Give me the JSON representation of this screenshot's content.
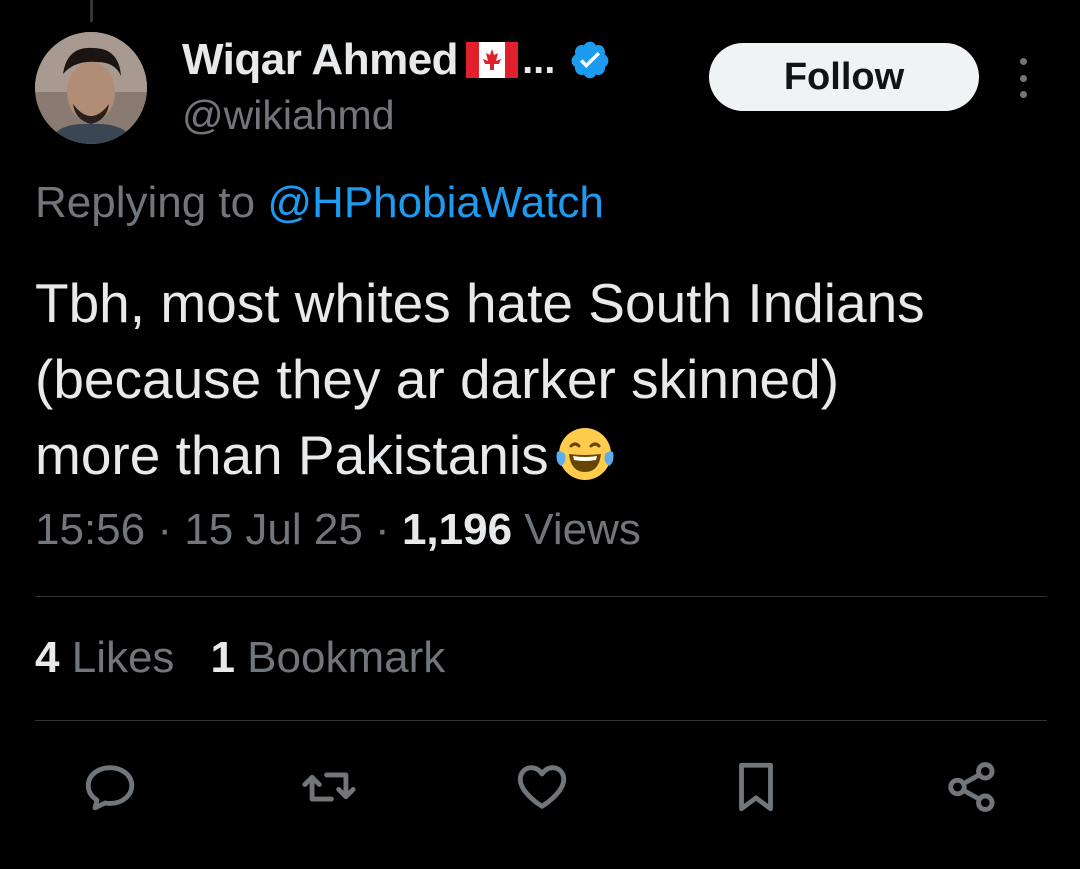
{
  "tweet": {
    "author": {
      "display_name": "Wiqar Ahmed",
      "name_truncation": "...",
      "handle": "@wikiahmd",
      "verified": true
    },
    "follow_label": "Follow",
    "reply_prefix": "Replying to",
    "reply_to": "@HPhobiaWatch",
    "text": "Tbh, most whites hate South Indians\n(because they ar darker skinned)\nmore than Pakistanis",
    "emoji": "face-with-tears-of-joy",
    "time": "15:56",
    "date": "15 Jul 25",
    "separator": "·",
    "views_count": "1,196",
    "views_label": "Views",
    "likes_count": "4",
    "likes_label": "Likes",
    "bookmarks_count": "1",
    "bookmarks_label": "Bookmark"
  },
  "icons": {
    "flag": "canada-flag-icon",
    "verified": "verified-badge-icon",
    "more": "more-options-icon",
    "reply": "reply-icon",
    "retweet": "retweet-icon",
    "like": "heart-icon",
    "bookmark": "bookmark-icon",
    "share": "share-icon"
  },
  "colors": {
    "background": "#000000",
    "text_primary": "#e7e9ea",
    "text_secondary": "#71767b",
    "accent": "#1d9bf0",
    "divider": "#2f3336",
    "follow_bg": "#eff3f4"
  }
}
